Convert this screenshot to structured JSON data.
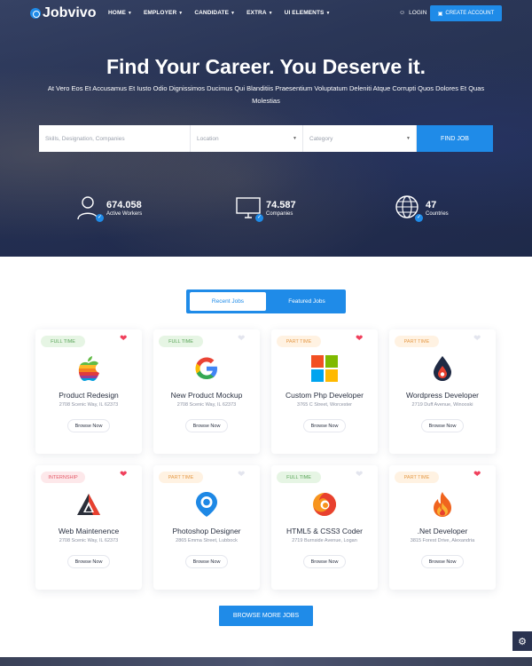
{
  "nav": {
    "brand": "Jobvivo",
    "menu": [
      "HOME",
      "EMPLOYER",
      "CANDIDATE",
      "EXTRA",
      "UI ELEMENTS"
    ],
    "login": "LOGIN",
    "create_account": "CREATE ACCOUNT"
  },
  "hero": {
    "title": "Find Your Career. You Deserve it.",
    "subtitle": "At Vero Eos Et Accusamus Et Iusto Odio Dignissimos Ducimus Qui Blanditiis Praesentium Voluptatum Deleniti Atque Corrupti Quos Dolores Et Quas Molestias"
  },
  "search": {
    "keywords_placeholder": "Skills, Designation, Companies",
    "location_placeholder": "Location",
    "category_placeholder": "Category",
    "button": "FIND JOB"
  },
  "stats": [
    {
      "value": "674.058",
      "label": "Active Workers"
    },
    {
      "value": "74.587",
      "label": "Companies"
    },
    {
      "value": "47",
      "label": "Countries"
    }
  ],
  "tabs": {
    "recent": "Recent Jobs",
    "featured": "Featured Jobs"
  },
  "jobs": [
    {
      "type": "FULL TIME",
      "title": "Product Redesign",
      "address": "2708 Scenic Way, IL 62373",
      "button": "Browse Now",
      "favorite": true,
      "logo": "apple-logo"
    },
    {
      "type": "FULL TIME",
      "title": "New Product Mockup",
      "address": "2708 Scenic Way, IL 62373",
      "button": "Browse Now",
      "favorite": false,
      "logo": "google-logo"
    },
    {
      "type": "PART TIME",
      "title": "Custom Php Developer",
      "address": "3765 C Street, Worcester",
      "button": "Browse Now",
      "favorite": true,
      "logo": "microsoft-logo"
    },
    {
      "type": "PART TIME",
      "title": "Wordpress Developer",
      "address": "2719 Duff Avenue, Winooski",
      "button": "Browse Now",
      "favorite": false,
      "logo": "drop-logo"
    },
    {
      "type": "INTERNSHIP",
      "title": "Web Maintenence",
      "address": "2708 Scenic Way, IL 62373",
      "button": "Browse Now",
      "favorite": true,
      "logo": "triangle-logo"
    },
    {
      "type": "PART TIME",
      "title": "Photoshop Designer",
      "address": "2865 Emma Street, Lubbock",
      "button": "Browse Now",
      "favorite": false,
      "logo": "pin-logo"
    },
    {
      "type": "FULL TIME",
      "title": "HTML5 & CSS3 Coder",
      "address": "2719 Burnside Avenue, Logan",
      "button": "Browse Now",
      "favorite": false,
      "logo": "firefox-logo"
    },
    {
      "type": "PART TIME",
      "title": ".Net Developer",
      "address": "3815 Forest Drive, Alexandria",
      "button": "Browse Now",
      "favorite": true,
      "logo": "flame-logo"
    }
  ],
  "browse_more": "BROWSE MORE JOBS",
  "colors": {
    "primary": "#1f8be8",
    "heart": "#f0405c"
  }
}
